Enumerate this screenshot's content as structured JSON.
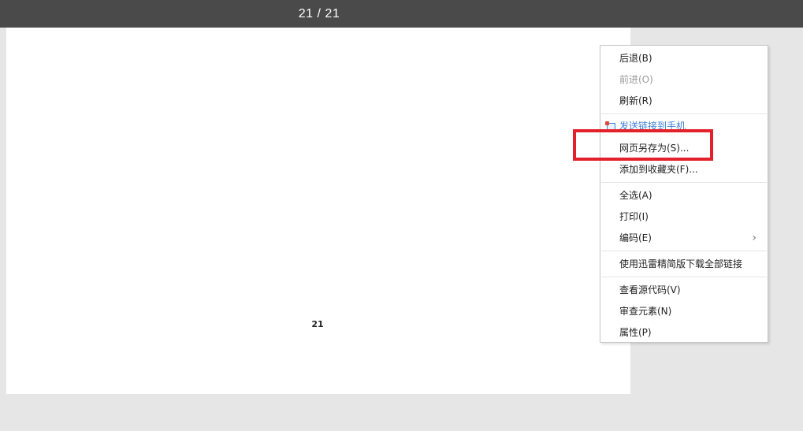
{
  "toolbar": {
    "page_counter": "21 / 21"
  },
  "page": {
    "number": "21"
  },
  "context_menu": {
    "items": {
      "back": "后退(B)",
      "forward": "前进(O)",
      "refresh": "刷新(R)",
      "send_link": "发送链接到手机",
      "save_as": "网页另存为(S)...",
      "add_favorites": "添加到收藏夹(F)...",
      "select_all": "全选(A)",
      "print": "打印(I)",
      "encoding": "编码(E)",
      "download_all": "使用迅雷精简版下载全部链接",
      "view_source": "查看源代码(V)",
      "inspect": "审查元素(N)",
      "properties": "属性(P)"
    },
    "submenu_glyph": "›"
  },
  "colors": {
    "toolbar_bg": "#4a4a4a",
    "highlight": "#e3212b",
    "link": "#3f7fd4",
    "disabled": "#9a9a9a"
  }
}
